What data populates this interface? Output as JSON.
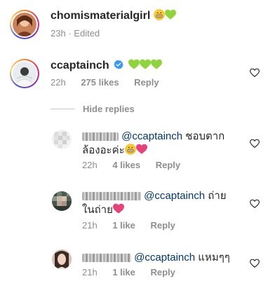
{
  "post": {
    "username": "chomismaterialgirl",
    "time": "23h",
    "separator": "·",
    "edited": "Edited",
    "emoji": [
      "grin-emoji",
      "green-heart-emoji"
    ]
  },
  "comment": {
    "username": "ccaptainch",
    "verified": true,
    "emoji": [
      "green-heart-emoji",
      "green-heart-emoji",
      "green-heart-emoji"
    ],
    "time": "22h",
    "likes": "275 likes",
    "reply": "Reply"
  },
  "hide_replies": "Hide replies",
  "replies": [
    {
      "mention": "@ccaptainch",
      "text_line1": " ชอบตาก",
      "text_line2": "ล้องอะค่ะ",
      "time": "22h",
      "likes": "4 likes",
      "reply": "Reply",
      "emoji": [
        "grin-emoji",
        "pink-heart-emoji"
      ]
    },
    {
      "mention": "@ccaptainch",
      "text_line1": " ถ่าย",
      "text_line2": "ในถ่าย",
      "time": "21h",
      "likes": "1 like",
      "reply": "Reply",
      "emoji": [
        "pink-heart-emoji"
      ]
    },
    {
      "mention": "@ccaptainch",
      "text_line1": " แหมๆๆ",
      "time": "21h",
      "likes": "1 like",
      "reply": "Reply"
    }
  ],
  "colors": {
    "mention": "#00376b",
    "meta": "#8e8e8e",
    "verified": "#3897f0",
    "green_heart": "#8fd43c",
    "pink_heart": "#e8427a"
  }
}
